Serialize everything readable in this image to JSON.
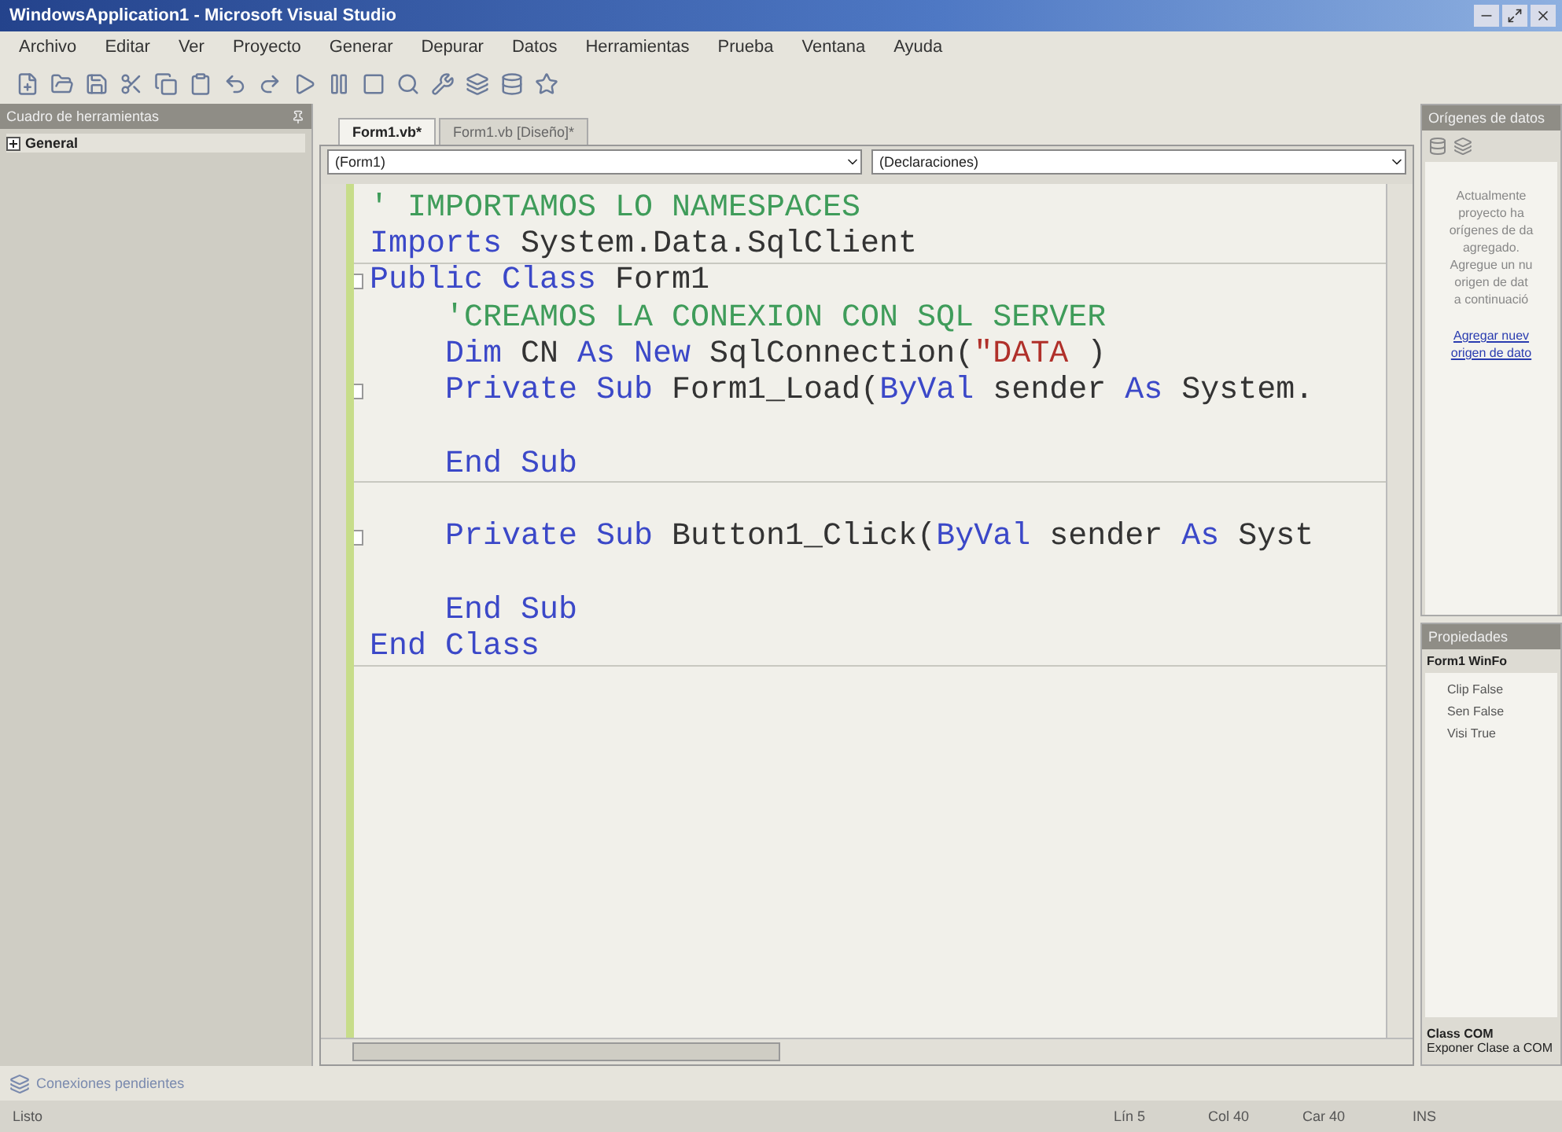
{
  "window": {
    "title": "WindowsApplication1 - Microsoft Visual Studio"
  },
  "menu": [
    "Archivo",
    "Editar",
    "Ver",
    "Proyecto",
    "Generar",
    "Depurar",
    "Datos",
    "Herramientas",
    "Prueba",
    "Ventana",
    "Ayuda"
  ],
  "toolbox": {
    "title": "Cuadro de herramientas",
    "group": {
      "label": "General",
      "expanded": false
    }
  },
  "tabs": [
    {
      "label": "Form1.vb*",
      "selected": true
    },
    {
      "label": "Form1.vb [Diseño]*",
      "selected": false
    }
  ],
  "editor": {
    "class_dropdown": "(Form1)",
    "member_dropdown": "(Declaraciones)",
    "lines": [
      {
        "separator": false,
        "fold": false,
        "tokens": [
          {
            "text": "' IMPORTAMOS LO NAMESPACES",
            "kind": "comment"
          }
        ]
      },
      {
        "separator": true,
        "fold": false,
        "tokens": [
          {
            "text": "Imports",
            "kind": "keyword"
          },
          {
            "text": " System.Data.SqlClient",
            "kind": "plain"
          }
        ]
      },
      {
        "separator": false,
        "fold": true,
        "tokens": [
          {
            "text": "Public Class",
            "kind": "keyword"
          },
          {
            "text": " Form1",
            "kind": "plain"
          }
        ]
      },
      {
        "separator": false,
        "fold": false,
        "tokens": [
          {
            "text": "    'CREAMOS LA CONEXION CON SQL SERVER",
            "kind": "comment"
          }
        ]
      },
      {
        "separator": false,
        "fold": false,
        "tokens": [
          {
            "text": "    Dim",
            "kind": "keyword"
          },
          {
            "text": " CN ",
            "kind": "plain"
          },
          {
            "text": "As New",
            "kind": "keyword"
          },
          {
            "text": " SqlConnection(",
            "kind": "plain"
          },
          {
            "text": "\"DATA ",
            "kind": "string"
          },
          {
            "text": ")",
            "kind": "plain"
          }
        ]
      },
      {
        "separator": false,
        "fold": true,
        "tokens": [
          {
            "text": "    Private Sub",
            "kind": "keyword"
          },
          {
            "text": " Form1_Load(",
            "kind": "plain"
          },
          {
            "text": "ByVal",
            "kind": "keyword"
          },
          {
            "text": " sender ",
            "kind": "plain"
          },
          {
            "text": "As",
            "kind": "keyword"
          },
          {
            "text": " System.",
            "kind": "plain"
          }
        ]
      },
      {
        "separator": false,
        "fold": false
      },
      {
        "separator": true,
        "fold": false,
        "tokens": [
          {
            "text": "    End Sub",
            "kind": "keyword"
          }
        ]
      },
      {
        "separator": false,
        "fold": false
      },
      {
        "separator": false,
        "fold": true,
        "tokens": [
          {
            "text": "    Private Sub",
            "kind": "keyword"
          },
          {
            "text": " Button1_Click(",
            "kind": "plain"
          },
          {
            "text": "ByVal",
            "kind": "keyword"
          },
          {
            "text": " sender ",
            "kind": "plain"
          },
          {
            "text": "As",
            "kind": "keyword"
          },
          {
            "text": " Syst",
            "kind": "plain"
          }
        ]
      },
      {
        "separator": false,
        "fold": false
      },
      {
        "separator": false,
        "fold": false,
        "tokens": [
          {
            "text": "    End Sub",
            "kind": "keyword"
          }
        ]
      },
      {
        "separator": true,
        "fold": false,
        "tokens": [
          {
            "text": "End Class",
            "kind": "keyword"
          }
        ]
      }
    ]
  },
  "data_sources": {
    "title": "Orígenes de datos",
    "message": [
      "Actualmente",
      "proyecto ha",
      "orígenes de da",
      "agregado.",
      "Agregue un nu",
      "origen de dat",
      "a continuació"
    ],
    "link": [
      "Agregar nuev",
      "origen de dato"
    ]
  },
  "properties": {
    "title": "Propiedades",
    "object": "Form1 WinFo",
    "rows": [
      {
        "name": "Clip",
        "value": "False"
      },
      {
        "name": "Sen",
        "value": "False"
      },
      {
        "name": "Visi",
        "value": "True"
      }
    ],
    "description_title": "Class COM",
    "description": "Exponer Clase a COM"
  },
  "pending": "Conexiones pendientes",
  "status_bar": {
    "state": "Listo",
    "line": "Lín 5",
    "col": "Col 40",
    "char": "Car 40",
    "mode": "INS"
  }
}
